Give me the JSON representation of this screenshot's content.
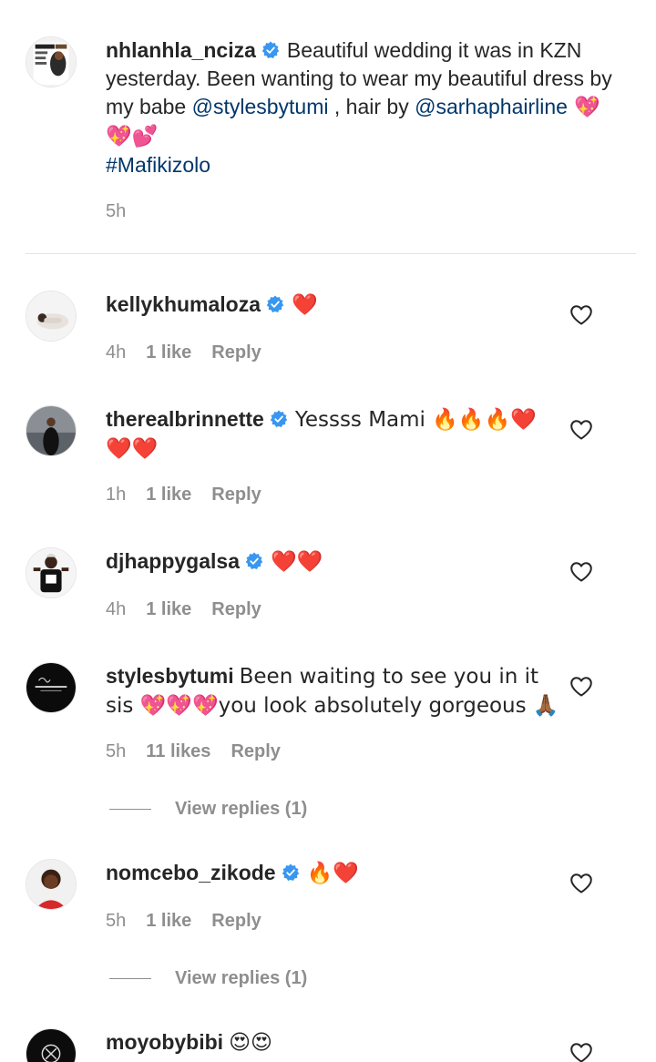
{
  "caption": {
    "username": "nhlanhla_nciza",
    "text_1": "Beautiful wedding it was in KZN yesterday. Been wanting to wear my beautiful dress by my babe ",
    "mention_1": "@stylesbytumi",
    "text_2": " , hair by ",
    "mention_2": "@sarhaphairline",
    "emoji": " 💖💖💕",
    "hashtag": "#Mafikizolo",
    "time": "5h"
  },
  "comments": [
    {
      "username": "kellykhumaloza",
      "text": "❤️",
      "time": "4h",
      "likes": "1 like",
      "reply": "Reply"
    },
    {
      "username": "therealbrinnette",
      "text": "Yessss Mami 🔥🔥🔥❤️❤️❤️",
      "time": "1h",
      "likes": "1 like",
      "reply": "Reply"
    },
    {
      "username": "djhappygalsa",
      "text": "❤️❤️",
      "time": "4h",
      "likes": "1 like",
      "reply": "Reply"
    },
    {
      "username": "stylesbytumi",
      "text": "Been waiting to see you in it sis 💖💖💖you look absolutely gorgeous 🙏🏾",
      "time": "5h",
      "likes": "11 likes",
      "reply": "Reply",
      "view_replies": "View replies (1)"
    },
    {
      "username": "nomcebo_zikode",
      "text": "🔥❤️",
      "time": "5h",
      "likes": "1 like",
      "reply": "Reply",
      "view_replies": "View replies (1)"
    },
    {
      "username": "moyobybibi",
      "text": "😍😍"
    }
  ],
  "colors": {
    "verified": "#3897f0",
    "mention": "#00376b",
    "meta": "#8e8e8e",
    "heart": "#ed1c24"
  },
  "icons": {
    "verified": "verified-badge-icon",
    "like": "heart-outline-icon"
  }
}
